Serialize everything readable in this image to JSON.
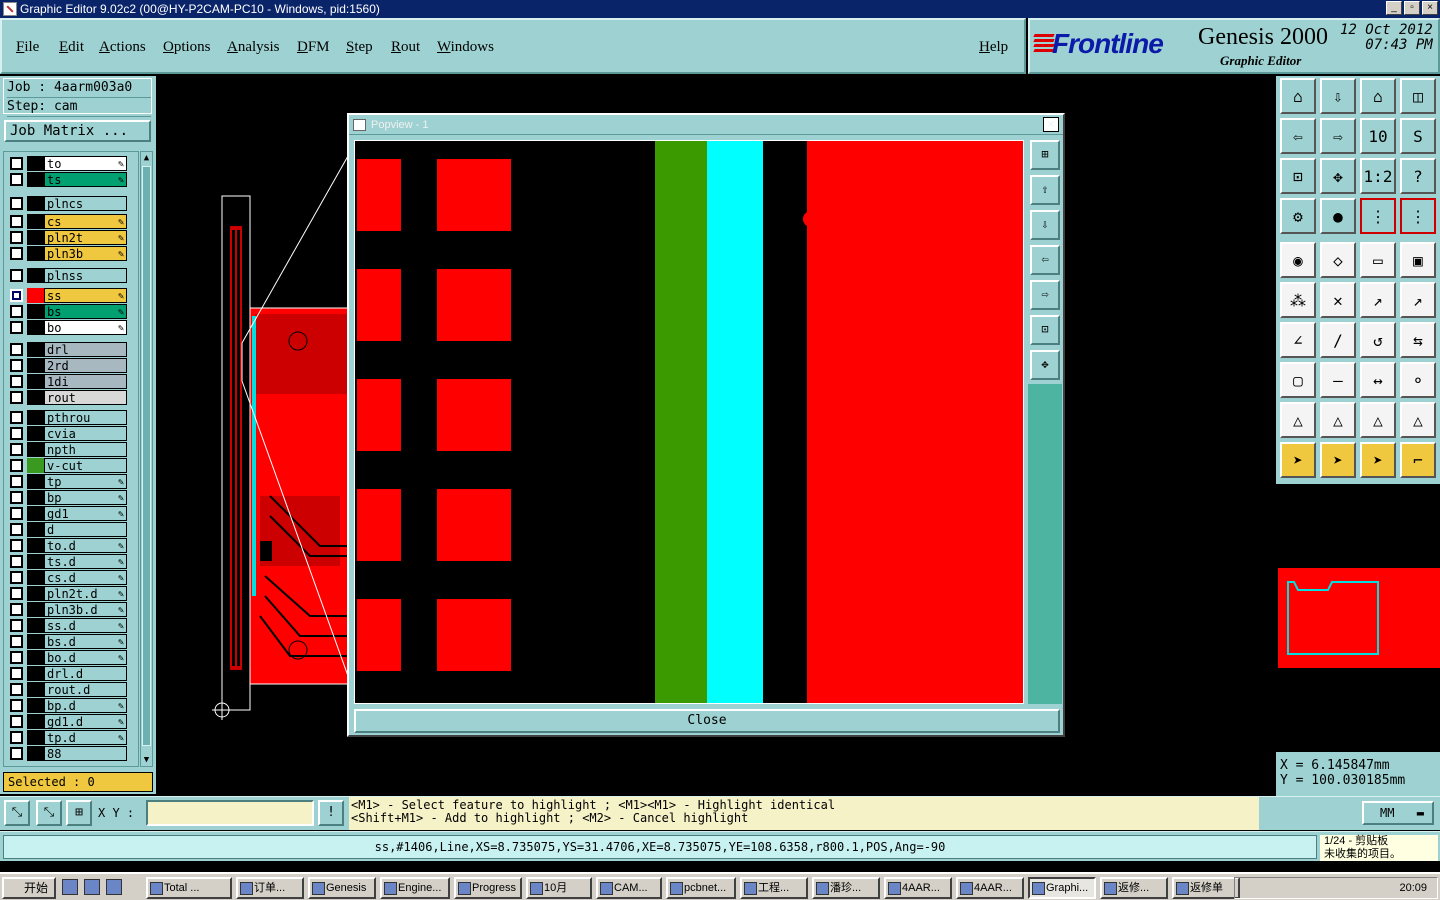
{
  "window": {
    "title": "Graphic Editor 9.02c2 (00@HY-P2CAM-PC10 - Windows, pid:1560)"
  },
  "menu": {
    "items": [
      "File",
      "Edit",
      "Actions",
      "Options",
      "Analysis",
      "DFM",
      "Step",
      "Rout",
      "Windows"
    ],
    "help": "Help"
  },
  "brand": {
    "logo": "Frontline",
    "product": "Genesis 2000",
    "subtitle": "Graphic Editor",
    "date": "12 Oct 2012",
    "time": "07:43 PM"
  },
  "job": {
    "job_line": "Job : 4aarm003a0",
    "step_line": "Step: cam",
    "matrix_button": "Job Matrix ..."
  },
  "layers": [
    {
      "name": "to",
      "color": "#ffffff",
      "swatch": "#000000",
      "editable": true
    },
    {
      "name": "ts",
      "color": "#00a070",
      "swatch": "#000000",
      "editable": true
    },
    {
      "name": "plncs",
      "color": "#9ed2d2",
      "swatch": "#000000",
      "editable": false
    },
    {
      "name": "cs",
      "color": "#f0c840",
      "swatch": "#000000",
      "editable": true
    },
    {
      "name": "pln2t",
      "color": "#f0c840",
      "swatch": "#000000",
      "editable": true
    },
    {
      "name": "pln3b",
      "color": "#f0c840",
      "swatch": "#000000",
      "editable": true
    },
    {
      "name": "plnss",
      "color": "#9ed2d2",
      "swatch": "#000000",
      "editable": false
    },
    {
      "name": "ss",
      "color": "#f0c840",
      "swatch": "#ff0000",
      "editable": true,
      "active": true
    },
    {
      "name": "bs",
      "color": "#00a070",
      "swatch": "#000000",
      "editable": true
    },
    {
      "name": "bo",
      "color": "#ffffff",
      "swatch": "#000000",
      "editable": true
    },
    {
      "name": "drl",
      "color": "#a8b8c0",
      "swatch": "#000000",
      "editable": false
    },
    {
      "name": "2rd",
      "color": "#a8b8c0",
      "swatch": "#000000",
      "editable": false
    },
    {
      "name": "1di",
      "color": "#a8b8c0",
      "swatch": "#000000",
      "editable": false
    },
    {
      "name": "rout",
      "color": "#d8d8d8",
      "swatch": "#000000",
      "editable": false
    },
    {
      "name": "pthrou",
      "color": "#9ed2d2",
      "swatch": "#000000",
      "editable": false
    },
    {
      "name": "cvia",
      "color": "#9ed2d2",
      "swatch": "#000000",
      "editable": false
    },
    {
      "name": "npth",
      "color": "#9ed2d2",
      "swatch": "#000000",
      "editable": false
    },
    {
      "name": "v-cut",
      "color": "#9ed2d2",
      "swatch": "#3a9a20",
      "editable": false
    },
    {
      "name": "tp",
      "color": "#9ed2d2",
      "swatch": "#000000",
      "editable": true
    },
    {
      "name": "bp",
      "color": "#9ed2d2",
      "swatch": "#000000",
      "editable": true
    },
    {
      "name": "gd1",
      "color": "#9ed2d2",
      "swatch": "#000000",
      "editable": true
    },
    {
      "name": "d",
      "color": "#9ed2d2",
      "swatch": "#000000",
      "editable": false
    },
    {
      "name": "to.d",
      "color": "#9ed2d2",
      "swatch": "#000000",
      "editable": true
    },
    {
      "name": "ts.d",
      "color": "#9ed2d2",
      "swatch": "#000000",
      "editable": true
    },
    {
      "name": "cs.d",
      "color": "#9ed2d2",
      "swatch": "#000000",
      "editable": true
    },
    {
      "name": "pln2t.d",
      "color": "#9ed2d2",
      "swatch": "#000000",
      "editable": true
    },
    {
      "name": "pln3b.d",
      "color": "#9ed2d2",
      "swatch": "#000000",
      "editable": true
    },
    {
      "name": "ss.d",
      "color": "#9ed2d2",
      "swatch": "#000000",
      "editable": true
    },
    {
      "name": "bs.d",
      "color": "#9ed2d2",
      "swatch": "#000000",
      "editable": true
    },
    {
      "name": "bo.d",
      "color": "#9ed2d2",
      "swatch": "#000000",
      "editable": true
    },
    {
      "name": "drl.d",
      "color": "#9ed2d2",
      "swatch": "#000000",
      "editable": false
    },
    {
      "name": "rout.d",
      "color": "#9ed2d2",
      "swatch": "#000000",
      "editable": false
    },
    {
      "name": "bp.d",
      "color": "#9ed2d2",
      "swatch": "#000000",
      "editable": true
    },
    {
      "name": "gd1.d",
      "color": "#9ed2d2",
      "swatch": "#000000",
      "editable": true
    },
    {
      "name": "tp.d",
      "color": "#9ed2d2",
      "swatch": "#000000",
      "editable": true
    },
    {
      "name": "88",
      "color": "#9ed2d2",
      "swatch": "#000000",
      "editable": false
    }
  ],
  "selected": "Selected : 0",
  "popview": {
    "title": "Popview - 1",
    "close_label": "Close"
  },
  "coords": {
    "x": "X  =  6.145847mm",
    "y": "Y  =  100.030185mm"
  },
  "cmd": {
    "xy_label": "X Y :",
    "xy_value": "",
    "message_line1": "<M1> - Select feature to highlight ; <M1><M1> - Highlight identical",
    "message_line2": "<Shift+M1> - Add to highlight ; <M2> - Cancel highlight",
    "unit": "MM"
  },
  "status": {
    "feature": "ss,#1406,Line,XS=8.735075,YS=31.4706,XE=8.735075,YE=108.6358,r800.1,POS,Ang=-90"
  },
  "clipboard": {
    "line1": "1/24 - 剪贴板",
    "line2": "未收集的项目。"
  },
  "taskbar": {
    "start": "开始",
    "tasks": [
      "Total ...",
      "订单...",
      "Genesis",
      "Engine...",
      "Progress",
      "10月",
      "CAM...",
      "pcbnet...",
      "工程...",
      "潘珍...",
      "4AAR...",
      "4AAR...",
      "Graphi...",
      "返修...",
      "返修单"
    ],
    "active_task": "Graphi...",
    "clock": "20:09"
  },
  "colors": {
    "panel": "#9ed2d2",
    "highlight": "#f0c840",
    "copper": "#ff0000",
    "title": "#0a246a"
  }
}
